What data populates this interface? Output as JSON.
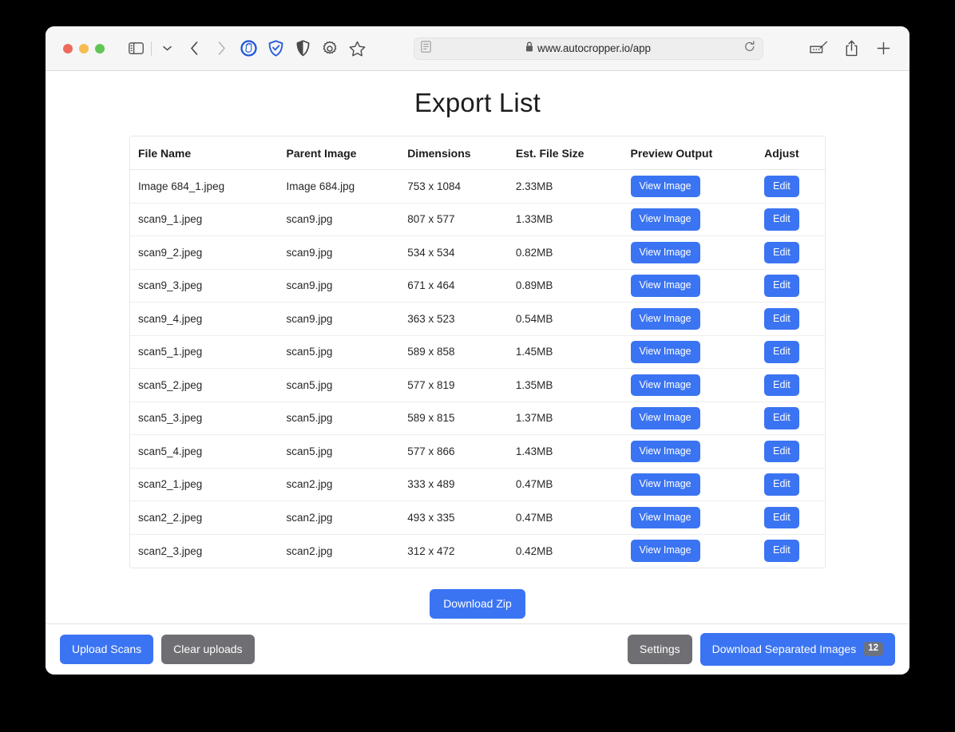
{
  "browser": {
    "url": "www.autocropper.io/app",
    "lock_icon": "lock-icon",
    "icons": {
      "sidebar": "sidebar-toggle-icon",
      "tab_overview": "chevron-down-icon",
      "back": "back-arrow-icon",
      "forward": "forward-arrow-icon",
      "adblock": "adblock-hand-icon",
      "shield_check": "shield-check-icon",
      "privacy": "half-shield-icon",
      "settings": "gear-icon",
      "bookmark": "star-icon",
      "reader": "reader-view-icon",
      "reload": "reload-icon",
      "markup": "markup-icon",
      "share": "share-icon",
      "new_tab": "plus-icon"
    }
  },
  "page": {
    "title": "Export List",
    "download_zip_label": "Download Zip"
  },
  "table": {
    "columns": [
      "File Name",
      "Parent Image",
      "Dimensions",
      "Est. File Size",
      "Preview Output",
      "Adjust"
    ],
    "preview_button_label": "View Image",
    "adjust_button_label": "Edit",
    "rows": [
      {
        "file_name": "Image 684_1.jpeg",
        "parent_image": "Image 684.jpg",
        "dimensions": "753 x 1084",
        "file_size": "2.33MB"
      },
      {
        "file_name": "scan9_1.jpeg",
        "parent_image": "scan9.jpg",
        "dimensions": "807 x 577",
        "file_size": "1.33MB"
      },
      {
        "file_name": "scan9_2.jpeg",
        "parent_image": "scan9.jpg",
        "dimensions": "534 x 534",
        "file_size": "0.82MB"
      },
      {
        "file_name": "scan9_3.jpeg",
        "parent_image": "scan9.jpg",
        "dimensions": "671 x 464",
        "file_size": "0.89MB"
      },
      {
        "file_name": "scan9_4.jpeg",
        "parent_image": "scan9.jpg",
        "dimensions": "363 x 523",
        "file_size": "0.54MB"
      },
      {
        "file_name": "scan5_1.jpeg",
        "parent_image": "scan5.jpg",
        "dimensions": "589 x 858",
        "file_size": "1.45MB"
      },
      {
        "file_name": "scan5_2.jpeg",
        "parent_image": "scan5.jpg",
        "dimensions": "577 x 819",
        "file_size": "1.35MB"
      },
      {
        "file_name": "scan5_3.jpeg",
        "parent_image": "scan5.jpg",
        "dimensions": "589 x 815",
        "file_size": "1.37MB"
      },
      {
        "file_name": "scan5_4.jpeg",
        "parent_image": "scan5.jpg",
        "dimensions": "577 x 866",
        "file_size": "1.43MB"
      },
      {
        "file_name": "scan2_1.jpeg",
        "parent_image": "scan2.jpg",
        "dimensions": "333 x 489",
        "file_size": "0.47MB"
      },
      {
        "file_name": "scan2_2.jpeg",
        "parent_image": "scan2.jpg",
        "dimensions": "493 x 335",
        "file_size": "0.47MB"
      },
      {
        "file_name": "scan2_3.jpeg",
        "parent_image": "scan2.jpg",
        "dimensions": "312 x 472",
        "file_size": "0.42MB"
      }
    ]
  },
  "footer": {
    "upload_label": "Upload Scans",
    "clear_label": "Clear uploads",
    "settings_label": "Settings",
    "download_separated_label": "Download Separated Images",
    "download_separated_count": "12"
  },
  "colors": {
    "accent_blue": "#3b74f2",
    "grey_button": "#6e6e73",
    "badge_grey": "#6b7280",
    "desktop": "#000000"
  }
}
